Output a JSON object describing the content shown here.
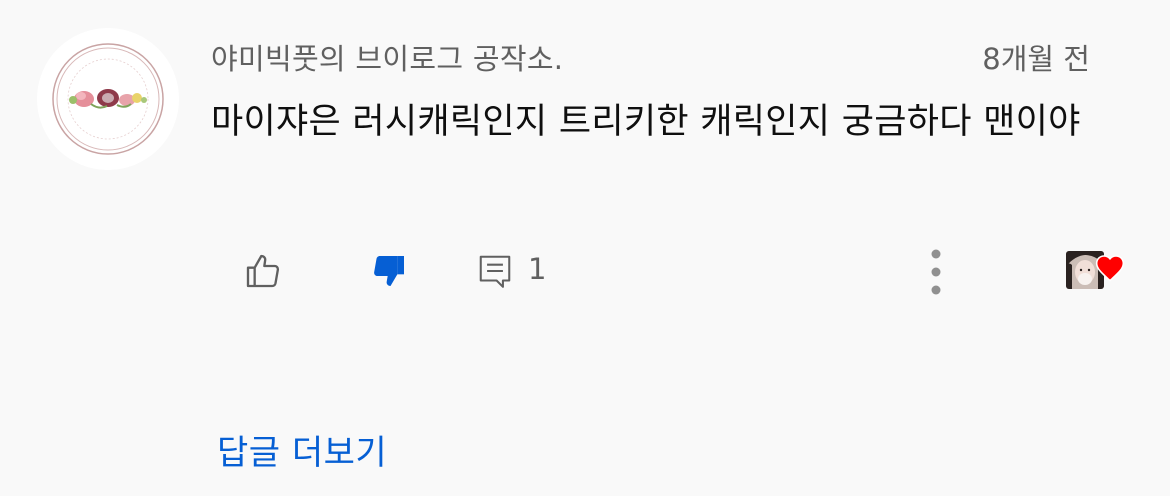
{
  "comment": {
    "author": "야미빅풋의 브이로그 공작소.",
    "timestamp": "8개월 전",
    "text": "마이쟈은 러시캐릭인지 트리키한 캐릭인지 궁금하다 맨이야",
    "reply_count": "1",
    "more_replies_label": "답글 더보기"
  },
  "icons": {
    "like": "thumbs-up-icon",
    "dislike": "thumbs-down-icon",
    "reply": "comment-icon",
    "more": "more-vertical-icon",
    "heart": "heart-icon"
  },
  "colors": {
    "background": "#f9f9f9",
    "primary_text": "#0f0f0f",
    "secondary_text": "#606060",
    "link_blue": "#065fd4",
    "dislike_active": "#065fd4",
    "heart_red": "#ff0000"
  },
  "state": {
    "disliked": true,
    "hearted_by_creator": true
  }
}
